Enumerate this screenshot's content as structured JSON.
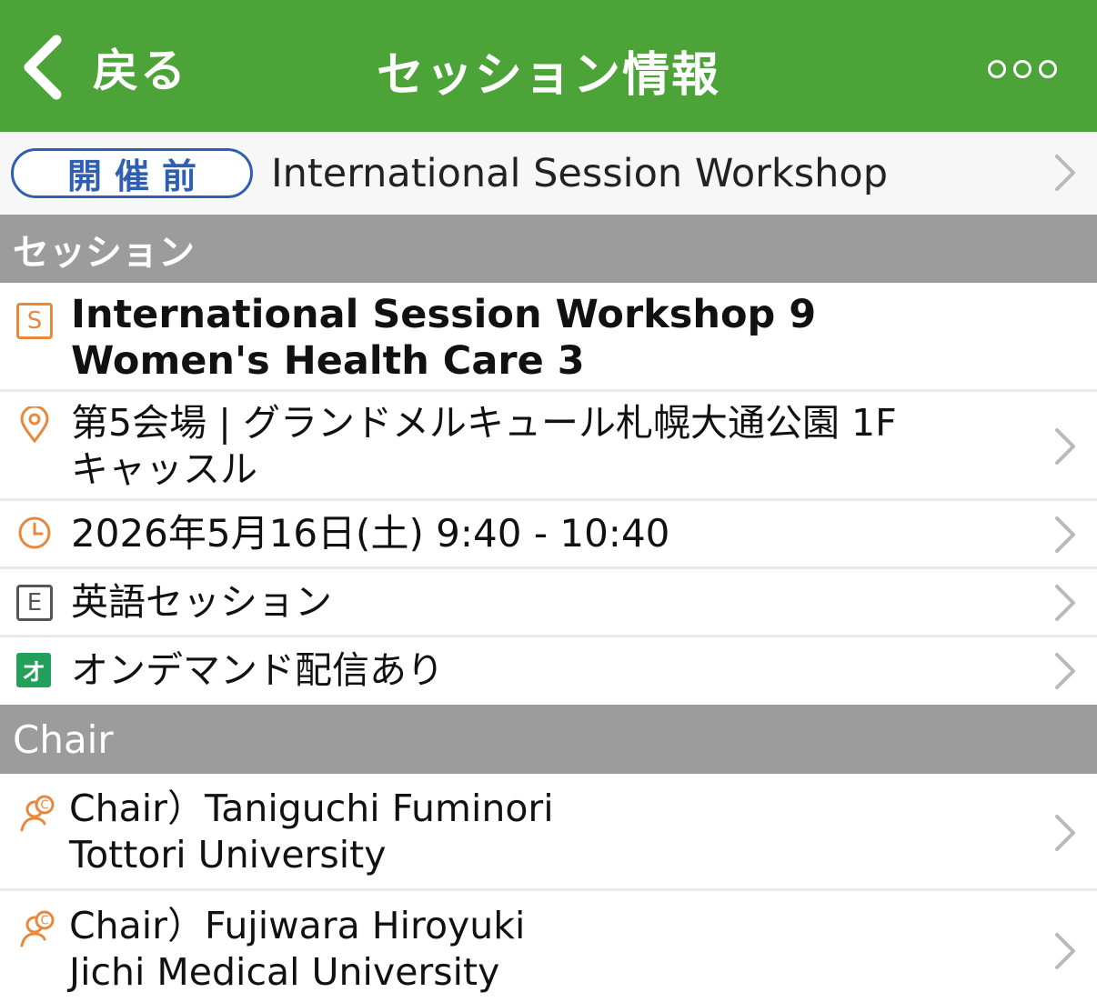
{
  "nav": {
    "back_label": "戻る",
    "title": "セッション情報",
    "back_icon": "chevron-left-icon",
    "more_icon": "more-dots-icon"
  },
  "status": {
    "badge": "開催前",
    "title": "International Session Workshop"
  },
  "sections": {
    "session": "セッション",
    "chair": "Chair"
  },
  "session": {
    "title_line1": "International Session Workshop 9",
    "title_line2": "Women's Health Care 3",
    "icon_letter": "S",
    "venue_line1": "第5会場 | グランドメルキュール札幌大通公園 1F",
    "venue_line2": "キャッスル",
    "datetime": "2026年5月16日(土) 9:40 - 10:40",
    "language_letter": "E",
    "language": "英語セッション",
    "ondemand_letter": "オ",
    "ondemand": "オンデマンド配信あり"
  },
  "chairs": [
    {
      "name": "Chair）Taniguchi Fuminori",
      "affiliation": "Tottori University"
    },
    {
      "name": "Chair）Fujiwara Hiroyuki",
      "affiliation": "Jichi Medical University"
    }
  ],
  "colors": {
    "nav_bg": "#4ca337",
    "badge": "#2f5fb3",
    "section_bg": "#9c9c9c",
    "icon_orange": "#e8883a",
    "ondemand_green": "#22a05a"
  }
}
